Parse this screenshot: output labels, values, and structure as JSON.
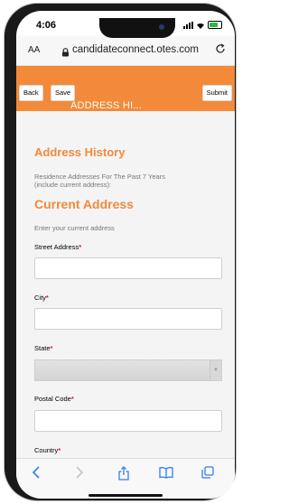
{
  "status": {
    "time": "4:06"
  },
  "browser": {
    "aa_label": "AA",
    "url": "candidateconnect.otes.com"
  },
  "header": {
    "back_label": "Back",
    "save_label": "Save",
    "submit_label": "Submit",
    "title": "ADDRESS HI..."
  },
  "form": {
    "section_title": "Address History",
    "section_desc_1": "Residence Addresses For The Past 7 Years",
    "section_desc_2": "(include current address):",
    "current_title": "Current Address",
    "current_hint": "Enter your current address",
    "fields": [
      {
        "label": "Street Address",
        "value": ""
      },
      {
        "label": "City",
        "value": ""
      },
      {
        "label": "State",
        "value": ""
      },
      {
        "label": "Postal Code",
        "value": ""
      },
      {
        "label": "Country",
        "value": ""
      }
    ],
    "required_marker": "*"
  },
  "toolbar": {
    "icons": [
      "back-icon",
      "forward-icon",
      "share-icon",
      "bookmarks-icon",
      "tabs-icon"
    ]
  },
  "colors": {
    "accent": "#f28a3a",
    "required": "#e02020",
    "link": "#2f7cf6"
  }
}
